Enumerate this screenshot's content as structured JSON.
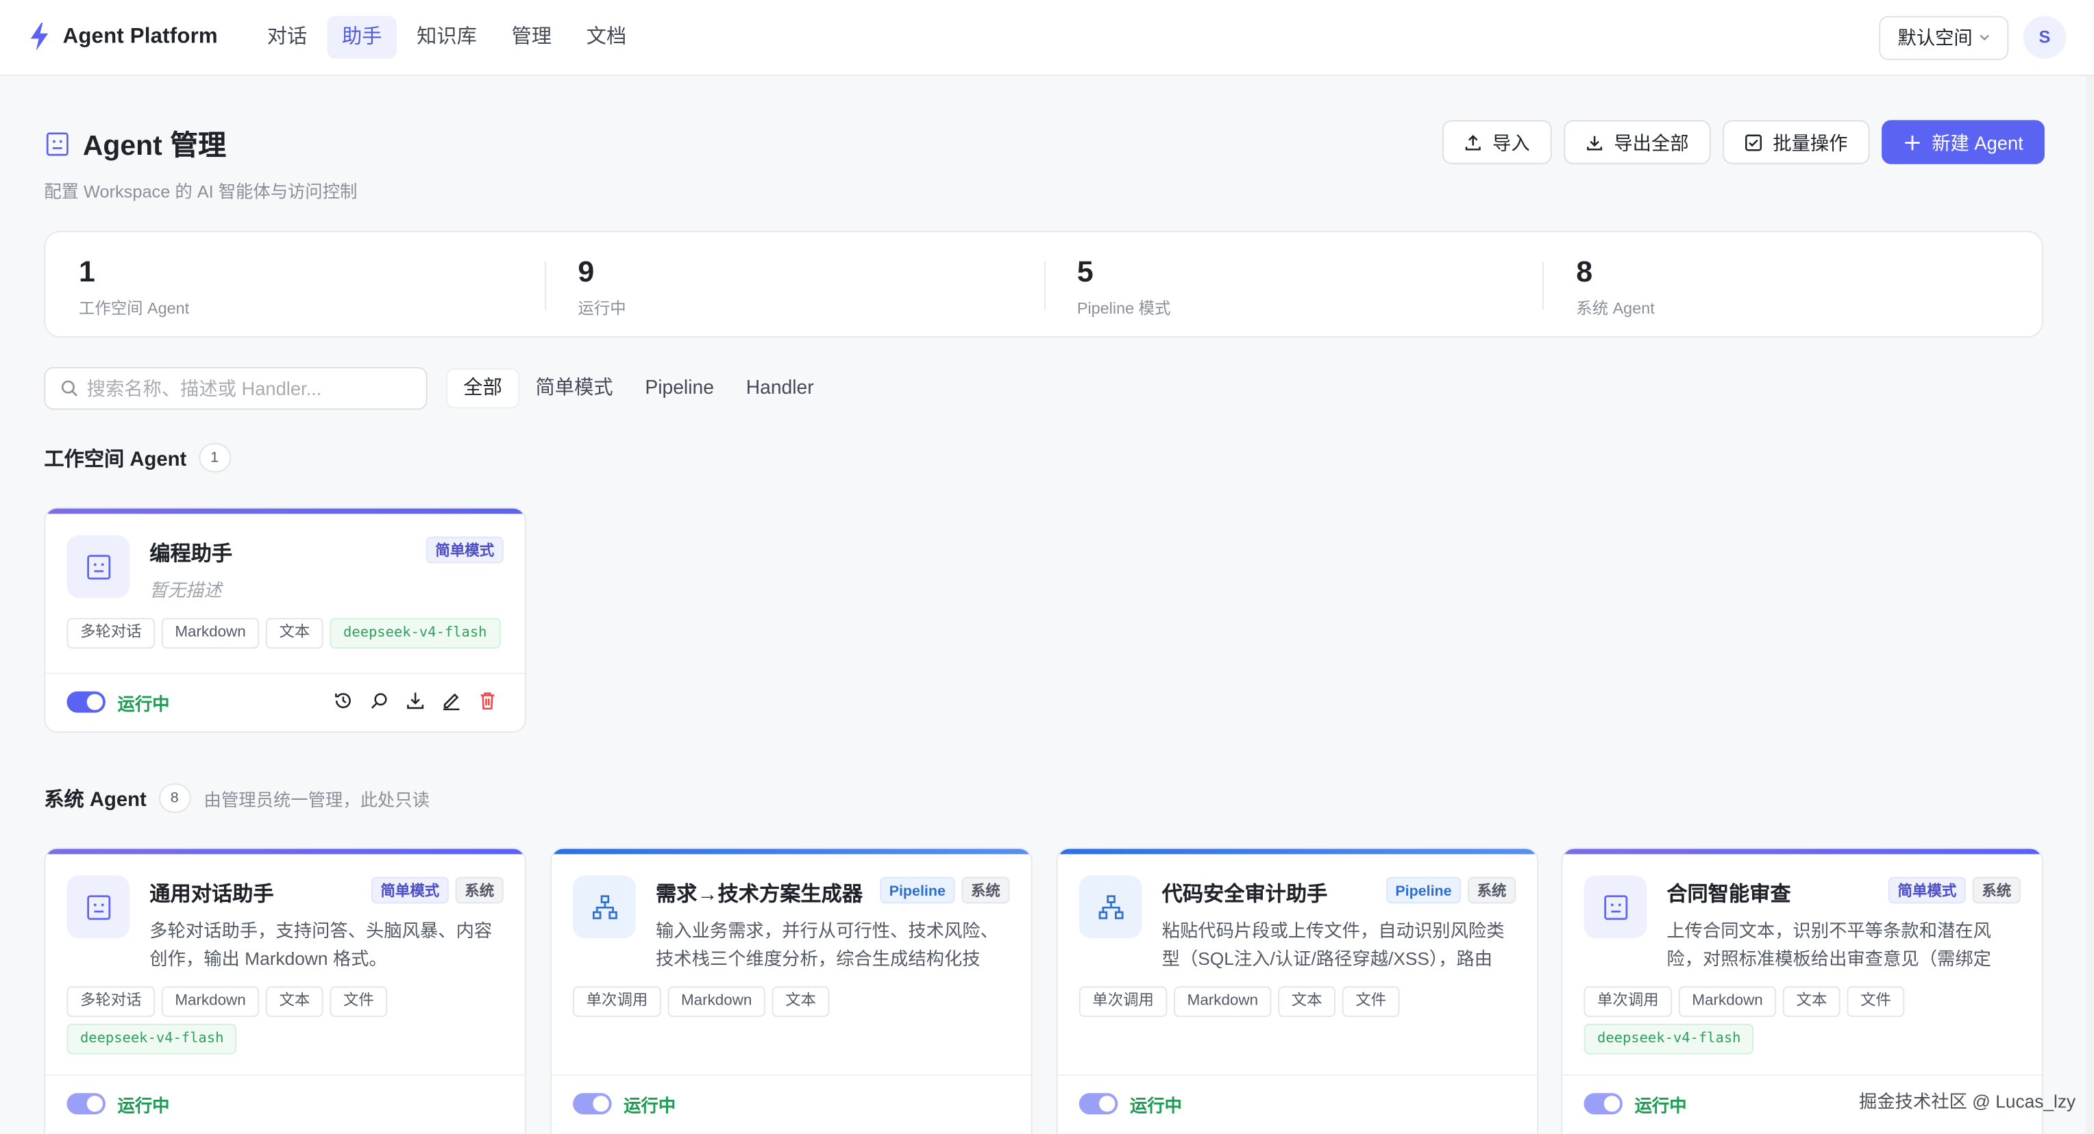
{
  "topbar": {
    "brand": "Agent Platform",
    "nav": [
      "对话",
      "助手",
      "知识库",
      "管理",
      "文档"
    ],
    "active_nav": "助手",
    "workspace": "默认空间",
    "avatar": "S"
  },
  "header": {
    "title": "Agent 管理",
    "subtitle": "配置 Workspace 的 AI 智能体与访问控制",
    "actions": {
      "import": "导入",
      "export_all": "导出全部",
      "batch": "批量操作",
      "new": "新建 Agent"
    }
  },
  "stats": [
    {
      "value": "1",
      "label": "工作空间 Agent"
    },
    {
      "value": "9",
      "label": "运行中"
    },
    {
      "value": "5",
      "label": "Pipeline 模式"
    },
    {
      "value": "8",
      "label": "系统 Agent"
    }
  ],
  "search": {
    "placeholder": "搜索名称、描述或 Handler..."
  },
  "filters": [
    "全部",
    "简单模式",
    "Pipeline",
    "Handler"
  ],
  "active_filter": "全部",
  "workspace_section": {
    "title": "工作空间 Agent",
    "count": "1",
    "cards": [
      {
        "name": "编程助手",
        "desc": "暂无描述",
        "badges": [
          "简单模式"
        ],
        "tags": [
          "多轮对话",
          "Markdown",
          "文本"
        ],
        "model": "deepseek-v4-flash",
        "status": "运行中"
      }
    ]
  },
  "system_section": {
    "title": "系统 Agent",
    "count": "8",
    "note": "由管理员统一管理，此处只读",
    "cards": [
      {
        "name": "通用对话助手",
        "desc": "多轮对话助手，支持问答、头脑风暴、内容创作，输出 Markdown 格式。",
        "badges": [
          "简单模式",
          "系统"
        ],
        "tags": [
          "多轮对话",
          "Markdown",
          "文本",
          "文件"
        ],
        "model": "deepseek-v4-flash",
        "status": "运行中"
      },
      {
        "name": "需求→技术方案生成器",
        "desc": "输入业务需求，并行从可行性、技术风险、技术栈三个维度分析，综合生成结构化技术...",
        "badges": [
          "Pipeline",
          "系统"
        ],
        "tags": [
          "单次调用",
          "Markdown",
          "文本"
        ],
        "status": "运行中"
      },
      {
        "name": "代码安全审计助手",
        "desc": "粘贴代码片段或上传文件，自动识别风险类型（SQL注入/认证/路径穿越/XSS），路由到...",
        "badges": [
          "Pipeline",
          "系统"
        ],
        "tags": [
          "单次调用",
          "Markdown",
          "文本",
          "文件"
        ],
        "status": "运行中"
      },
      {
        "name": "合同智能审查",
        "desc": "上传合同文本，识别不平等条款和潜在风险，对照标准模板给出审查意见（需绑定合...",
        "badges": [
          "简单模式",
          "系统"
        ],
        "tags": [
          "单次调用",
          "Markdown",
          "文本",
          "文件"
        ],
        "model": "deepseek-v4-flash",
        "status": "运行中"
      }
    ]
  },
  "watermark": "掘金技术社区 @ Lucas_lzy",
  "colors": {
    "accent": "#5b63f3",
    "running": "#1f9d55",
    "danger": "#e5484d"
  }
}
